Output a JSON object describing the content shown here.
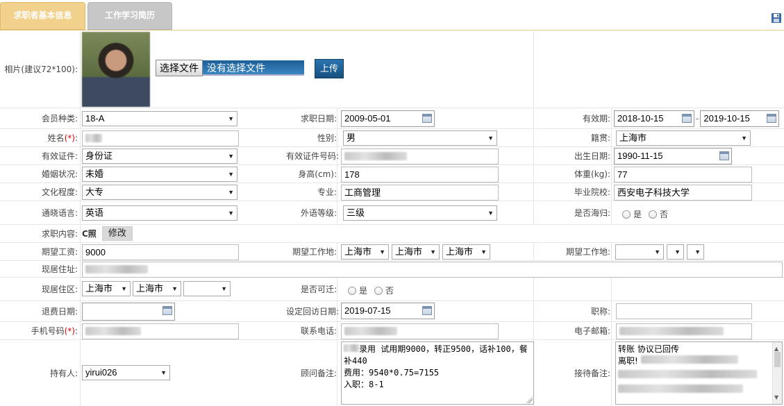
{
  "tabs": [
    {
      "label": "求职者基本信息",
      "active": true
    },
    {
      "label": "工作学习简历",
      "active": false
    }
  ],
  "photo": {
    "label": "相片(建议72*100):",
    "choose_button": "选择文件",
    "file_status": "没有选择文件",
    "upload_button": "上传"
  },
  "fields": {
    "member_type": {
      "label": "会员种类:",
      "value": "18-A"
    },
    "job_date": {
      "label": "求职日期:",
      "value": "2009-05-01"
    },
    "valid_period": {
      "label": "有效期:",
      "start": "2018-10-15",
      "sep": "-",
      "end": "2019-10-15"
    },
    "name": {
      "label": "姓名",
      "req": "(*)",
      "colon": ":"
    },
    "gender": {
      "label": "性别:",
      "value": "男"
    },
    "native_place": {
      "label": "籍贯:",
      "value": "上海市"
    },
    "id_type": {
      "label": "有效证件:",
      "value": "身份证"
    },
    "id_number": {
      "label": "有效证件号码:"
    },
    "birth_date": {
      "label": "出生日期:",
      "value": "1990-11-15"
    },
    "marital": {
      "label": "婚姻状况:",
      "value": "未婚"
    },
    "height": {
      "label": "身高(cm):",
      "value": "178"
    },
    "weight": {
      "label": "体重(kg):",
      "value": "77"
    },
    "education": {
      "label": "文化程度:",
      "value": "大专"
    },
    "major": {
      "label": "专业:",
      "value": "工商管理"
    },
    "school": {
      "label": "毕业院校:",
      "value": "西安电子科技大学"
    },
    "language": {
      "label": "通晓语言:",
      "value": "英语"
    },
    "lang_level": {
      "label": "外语等级:",
      "value": "三级"
    },
    "returnee": {
      "label": "是否海归:",
      "yes": "是",
      "no": "否"
    },
    "job_content": {
      "label": "求职内容:",
      "value": "C照",
      "edit_button": "修改"
    },
    "expected_salary": {
      "label": "期望工资:",
      "value": "9000"
    },
    "expected_location": {
      "label": "期望工作地:",
      "province": "上海市",
      "city": "上海市",
      "district": "上海市"
    },
    "expected_location2": {
      "label": "期望工作地:"
    },
    "current_address": {
      "label": "现居住址:"
    },
    "current_area": {
      "label": "现居住区:",
      "province": "上海市",
      "city": "上海市"
    },
    "relocate": {
      "label": "是否可迁:",
      "yes": "是",
      "no": "否"
    },
    "refund_date": {
      "label": "退费日期:"
    },
    "revisit_date": {
      "label": "设定回访日期:",
      "value": "2019-07-15"
    },
    "title": {
      "label": "职称:"
    },
    "mobile": {
      "label": "手机号码",
      "req": "(*)",
      "colon": ":"
    },
    "phone": {
      "label": "联系电话:"
    },
    "email": {
      "label": "电子邮箱:"
    },
    "holder": {
      "label": "持有人:",
      "value": "yirui026"
    },
    "consultant_note": {
      "label": "顾问备注:",
      "text": "录用 试用期9000，转正9500，话补100，餐补440\n费用：9540*0.75=7155\n入职：8-1"
    },
    "reception_note": {
      "label": "接待备注:",
      "line1": "转账 协议已回传",
      "line2": "离职!"
    }
  }
}
